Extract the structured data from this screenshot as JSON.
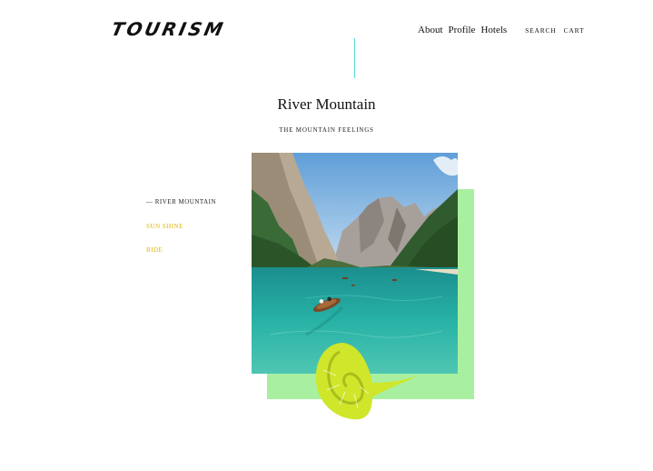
{
  "header": {
    "logo": "TOURISM",
    "nav": [
      {
        "label": "About"
      },
      {
        "label": "Profile"
      },
      {
        "label": "Hotels"
      }
    ],
    "utility": [
      {
        "label": "SEARCH"
      },
      {
        "label": "CART"
      }
    ]
  },
  "hero": {
    "title": "River Mountain",
    "subtitle": "THE MOUNTAIN FEELINGS"
  },
  "sidebar": {
    "items": [
      {
        "label": "— RIVER MOUNTAIN"
      },
      {
        "label": "SUN SHINE"
      },
      {
        "label": "RIDE"
      }
    ]
  },
  "colors": {
    "accent_line": "#56d9d9",
    "accent_green": "#a8f0a0",
    "accent_gold": "#e2b400",
    "shell": "#cfe62a"
  },
  "icons": {
    "shell": "shell-icon"
  }
}
